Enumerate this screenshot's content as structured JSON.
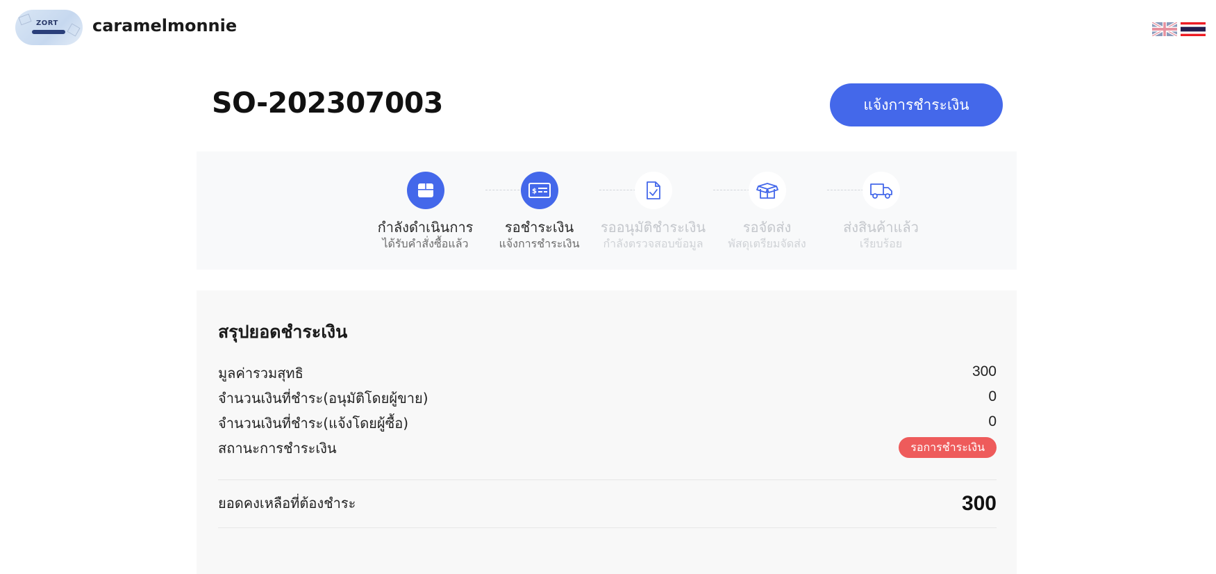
{
  "header": {
    "shop_name": "caramelmonnie",
    "logo_text": "ZORT",
    "languages": [
      {
        "icon": "uk-flag-icon",
        "active": false
      },
      {
        "icon": "thai-flag-icon",
        "active": true
      }
    ]
  },
  "order": {
    "number": "SO-202307003",
    "pay_button_label": "แจ้งการชำระเงิน"
  },
  "steps": [
    {
      "title": "กำลังดำเนินการ",
      "subtitle": "ได้รับคำสั่งซื้อแล้ว",
      "icon": "box-icon",
      "active": true
    },
    {
      "title": "รอชำระเงิน",
      "subtitle": "แจ้งการชำระเงิน",
      "icon": "payment-card-icon",
      "active": true
    },
    {
      "title": "รออนุมัติชำระเงิน",
      "subtitle": "กำลังตรวจสอบข้อมูล",
      "icon": "document-check-icon",
      "active": false
    },
    {
      "title": "รอจัดส่ง",
      "subtitle": "พัสดุเตรียมจัดส่ง",
      "icon": "package-open-icon",
      "active": false
    },
    {
      "title": "ส่งสินค้าแล้ว",
      "subtitle": "เรียบร้อย",
      "icon": "truck-icon",
      "active": false
    }
  ],
  "colors": {
    "accent": "#4468ea",
    "status_unpaid": "#ee5b5b",
    "inactive_text": "#c4c7cc"
  },
  "summary": {
    "title": "สรุปยอดชำระเงิน",
    "rows": [
      {
        "label": "มูลค่ารวมสุทธิ",
        "value": "300"
      },
      {
        "label": "จำนวนเงินที่ชำระ(อนุมัติโดยผู้ขาย)",
        "value": "0"
      },
      {
        "label": "จำนวนเงินที่ชำระ(แจ้งโดยผู้ซื้อ)",
        "value": "0"
      }
    ],
    "status_label": "สถานะการชำระเงิน",
    "status_value": "รอการชำระเงิน",
    "balance_label": "ยอดคงเหลือที่ต้องชำระ",
    "balance_value": "300"
  }
}
